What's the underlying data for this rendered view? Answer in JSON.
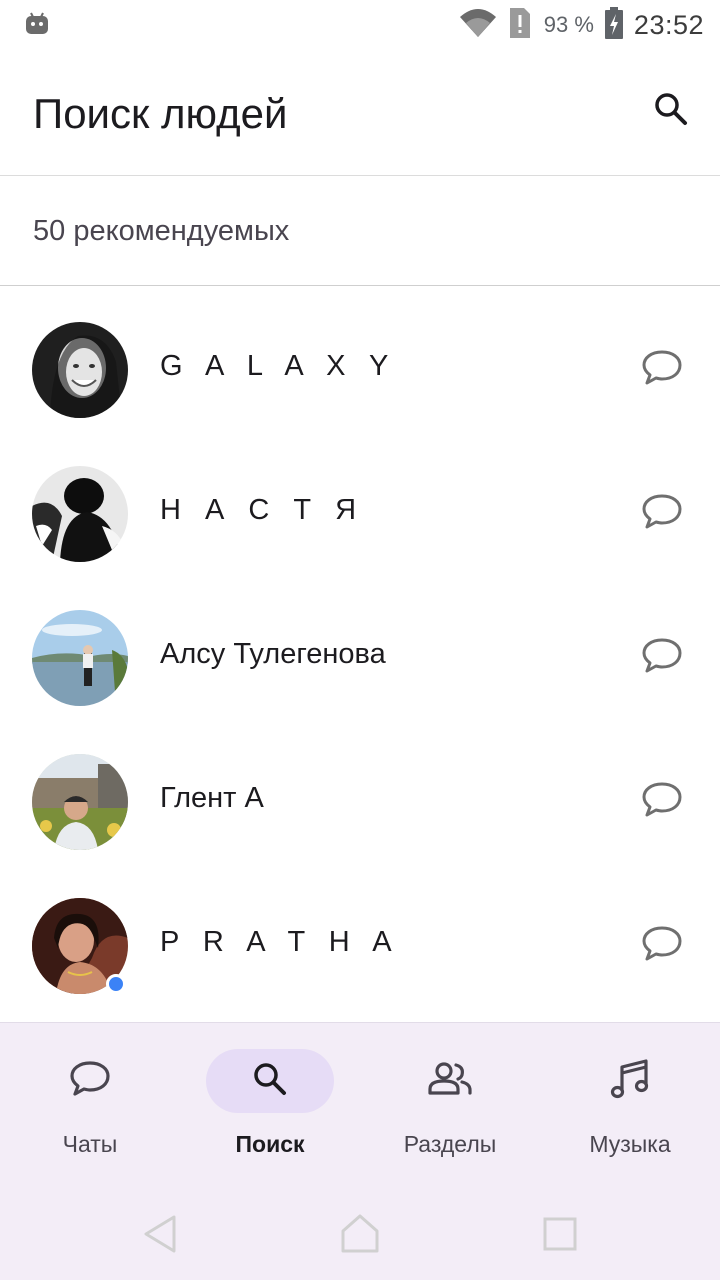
{
  "status_bar": {
    "battery_percent": "93 %",
    "time": "23:52",
    "icons": [
      "android-icon",
      "wifi-icon",
      "sim-alert-icon",
      "battery-charging-icon"
    ]
  },
  "header": {
    "title": "Поиск людей",
    "search_icon": "search-icon"
  },
  "section": {
    "title": "50 рекомендуемых"
  },
  "people": [
    {
      "name": "G A L A X Y",
      "online": false
    },
    {
      "name": "Н А С Т Я",
      "online": false
    },
    {
      "name": "Алсу Тулегенова",
      "online": false
    },
    {
      "name": "Глент А",
      "online": false
    },
    {
      "name": "P R A T H A",
      "online": true
    }
  ],
  "bottom_nav": {
    "items": [
      {
        "label": "Чаты",
        "icon": "chat-bubble-icon",
        "active": false
      },
      {
        "label": "Поиск",
        "icon": "search-icon",
        "active": true
      },
      {
        "label": "Разделы",
        "icon": "people-icon",
        "active": false
      },
      {
        "label": "Музыка",
        "icon": "music-note-icon",
        "active": false
      }
    ]
  },
  "system_nav": {
    "icons": [
      "back-icon",
      "home-icon",
      "recents-icon"
    ]
  },
  "colors": {
    "accent_pill": "#e6dcf6",
    "nav_background": "#f3edf7",
    "online_dot": "#3b82f6"
  }
}
